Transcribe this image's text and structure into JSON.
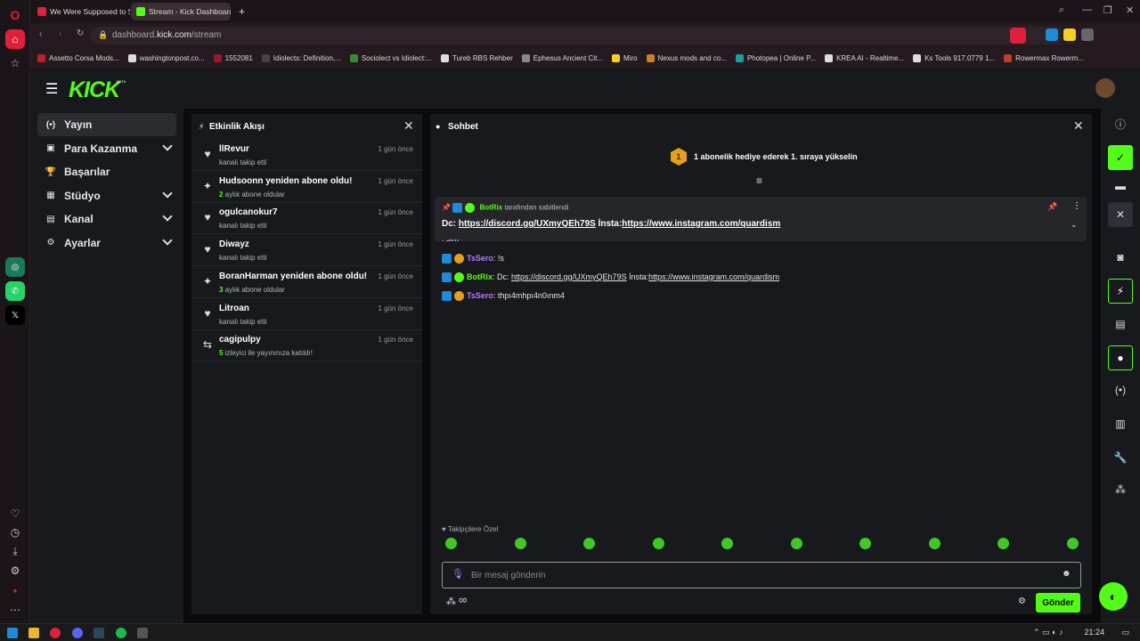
{
  "browser": {
    "tabs": [
      {
        "title": "We Were Supposed to St",
        "favicon_color": "#e0203a",
        "active": false
      },
      {
        "title": "Stream - Kick Dashboard",
        "favicon_color": "#53fc18",
        "active": true
      }
    ],
    "url_prefix": "dashboard.",
    "url_domain": "kick.com",
    "url_path": "/stream",
    "bookmarks": [
      {
        "label": "Assetto Corsa Mods...",
        "color": "#c0202a"
      },
      {
        "label": "washingtonpost.co...",
        "color": "#dddddd"
      },
      {
        "label": "1552081",
        "color": "#9a1a2a"
      },
      {
        "label": "Idiolects: Definition,...",
        "color": "#444444"
      },
      {
        "label": "Sociolect vs Idiolect:...",
        "color": "#3a8a3a"
      },
      {
        "label": "Tureb RBS Rehber",
        "color": "#dddddd"
      },
      {
        "label": "Ephesus Ancient Cit...",
        "color": "#888888"
      },
      {
        "label": "Miro",
        "color": "#f5d020"
      },
      {
        "label": "Nexus mods and co...",
        "color": "#d08020"
      },
      {
        "label": "Photopea | Online P...",
        "color": "#18a0a0"
      },
      {
        "label": "KREA AI - Realtime...",
        "color": "#dddddd"
      },
      {
        "label": "Ks Tools 917.0779 1...",
        "color": "#dddddd"
      },
      {
        "label": "Rowermax Rowerm...",
        "color": "#c04020"
      }
    ],
    "clock": "21:24"
  },
  "kick": {
    "logo": "KICK",
    "logo_sup": "BETA",
    "brand_color": "#53fc18",
    "nav": [
      {
        "label": "Yayın",
        "icon": "(•)",
        "active": true,
        "expandable": false
      },
      {
        "label": "Para Kazanma",
        "icon": "▣",
        "active": false,
        "expandable": true
      },
      {
        "label": "Başarılar",
        "icon": "🏆",
        "active": false,
        "expandable": false
      },
      {
        "label": "Stüdyo",
        "icon": "▦",
        "active": false,
        "expandable": true
      },
      {
        "label": "Kanal",
        "icon": "▤",
        "active": false,
        "expandable": true
      },
      {
        "label": "Ayarlar",
        "icon": "⚙",
        "active": false,
        "expandable": true
      }
    ],
    "activity": {
      "title": "Etkinlik Akışı",
      "items": [
        {
          "icon": "♥",
          "name": "llRevur",
          "num": "",
          "sub": "kanalı takip etti",
          "time": "1 gün önce"
        },
        {
          "icon": "✦",
          "name": "Hudsoonn yeniden abone oldu!",
          "num": "2",
          "sub": " aylık abone oldular",
          "time": "1 gün önce"
        },
        {
          "icon": "♥",
          "name": "ogulcanokur7",
          "num": "",
          "sub": "kanalı takip etti",
          "time": "1 gün önce"
        },
        {
          "icon": "♥",
          "name": "Diwayz",
          "num": "",
          "sub": "kanalı takip etti",
          "time": "1 gün önce"
        },
        {
          "icon": "✦",
          "name": "BoranHarman yeniden abone oldu!",
          "num": "3",
          "sub": " aylık abone oldular",
          "time": "1 gün önce"
        },
        {
          "icon": "♥",
          "name": "Litroan",
          "num": "",
          "sub": "kanalı takip etti",
          "time": "1 gün önce"
        },
        {
          "icon": "⇆",
          "name": "cagipulpy",
          "num": "5",
          "sub": " izleyici ile yayınınıza katıldı!",
          "time": "1 gün önce"
        }
      ]
    },
    "chat": {
      "title": "Sohbet",
      "sub_goal_rank": "1",
      "sub_goal_text": "1 abonelik hediye ederek 1. sıraya yükselin",
      "pinned": {
        "user": "BotRix",
        "suffix": "tarafından sabitlendi",
        "text_prefix": "Dc: ",
        "link1": "https://discord.gg/UXmyQEh79S",
        "text_mid": " İnsta:",
        "link2": "https://www.instagram.com/quardism"
      },
      "messages": [
        {
          "user": "",
          "text": ": sim",
          "cls": "u-red"
        },
        {
          "user": "TsSero",
          "text": ": !s",
          "cls": "u-sero"
        },
        {
          "user": "BotRix",
          "text": ": Dc: ",
          "link1": "https://discord.gg/UXmyQEh79S",
          "mid": " İnsta:",
          "link2": "https://www.instagram.com/quardism",
          "cls": "u-bot"
        },
        {
          "user": "TsSero",
          "text": ": thpı4mhpı4n0ınm4",
          "cls": "u-sero"
        }
      ],
      "followers_only": "Takipçilere Özel",
      "input_placeholder": "Bir mesaj gönderin",
      "send_label": "Gönder",
      "infinity": "∞"
    }
  }
}
